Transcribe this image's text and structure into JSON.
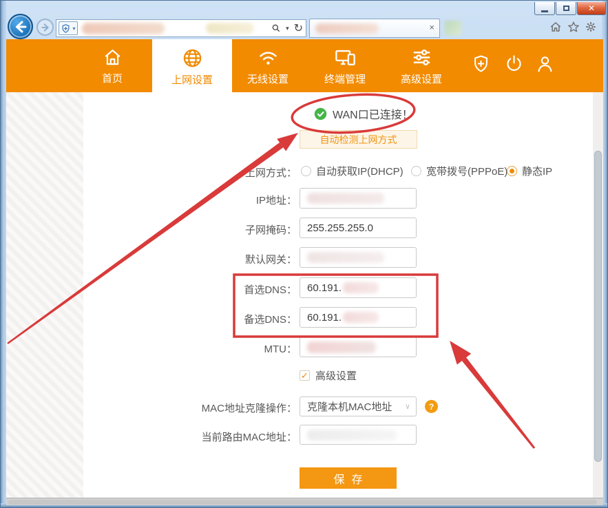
{
  "colors": {
    "accent_orange": "#f28b00",
    "annotation_red": "#d93a3a",
    "success_green": "#44b549"
  },
  "browser": {
    "window_controls": {
      "minimize_icon": "minimize-bar",
      "maximize_icon": "maximize-square",
      "close_label": "✕"
    },
    "nav_icons": [
      "back-arrow-icon",
      "forward-arrow-icon"
    ],
    "address_bar": {
      "site_icon": "shield-plus-icon",
      "url_redacted": true,
      "tools": [
        "search-icon",
        "dropdown-caret-icon",
        "refresh-icon"
      ],
      "caret_glyph": "▾",
      "refresh_glyph": "↻"
    },
    "tab": {
      "title_redacted": true,
      "close_label": "×"
    },
    "toolbar_icons": [
      "home-icon",
      "star-icon",
      "gear-icon"
    ]
  },
  "nav": {
    "items": [
      {
        "label": "首页",
        "icon": "home-icon",
        "active": false
      },
      {
        "label": "上网设置",
        "icon": "globe-icon",
        "active": true
      },
      {
        "label": "无线设置",
        "icon": "wifi-icon",
        "active": false
      },
      {
        "label": "终端管理",
        "icon": "devices-icon",
        "active": false
      },
      {
        "label": "高级设置",
        "icon": "sliders-icon",
        "active": false
      }
    ],
    "right_icons": [
      "shield-plus-icon",
      "power-icon",
      "user-icon"
    ]
  },
  "main": {
    "status": {
      "icon": "check-circle-icon",
      "text": "WAN口已连接！"
    },
    "detect_button": "自动检测上网方式",
    "mode": {
      "label": "上网方式：",
      "options": [
        {
          "label": "自动获取IP(DHCP)",
          "selected": false
        },
        {
          "label": "宽带拨号(PPPoE)",
          "selected": false
        },
        {
          "label": "静态IP",
          "selected": true
        }
      ]
    },
    "fields": [
      {
        "label": "IP地址：",
        "value": "",
        "redacted": true
      },
      {
        "label": "子网掩码：",
        "value": "255.255.255.0",
        "redacted": false
      },
      {
        "label": "默认网关：",
        "value": "",
        "redacted": true
      },
      {
        "label": "首选DNS：",
        "value": "60.191.",
        "redacted_suffix": true
      },
      {
        "label": "备选DNS：",
        "value": "60.191.",
        "redacted_suffix": true
      },
      {
        "label": "MTU：",
        "value": "",
        "redacted": true
      }
    ],
    "advanced": {
      "label": "高级设置",
      "checked": true
    },
    "mac_clone": {
      "label": "MAC地址克隆操作：",
      "value": "克隆本机MAC地址",
      "help_icon": "question-icon"
    },
    "current_mac": {
      "label": "当前路由MAC地址：",
      "value": "",
      "redacted": true
    },
    "save_button": "保存"
  }
}
